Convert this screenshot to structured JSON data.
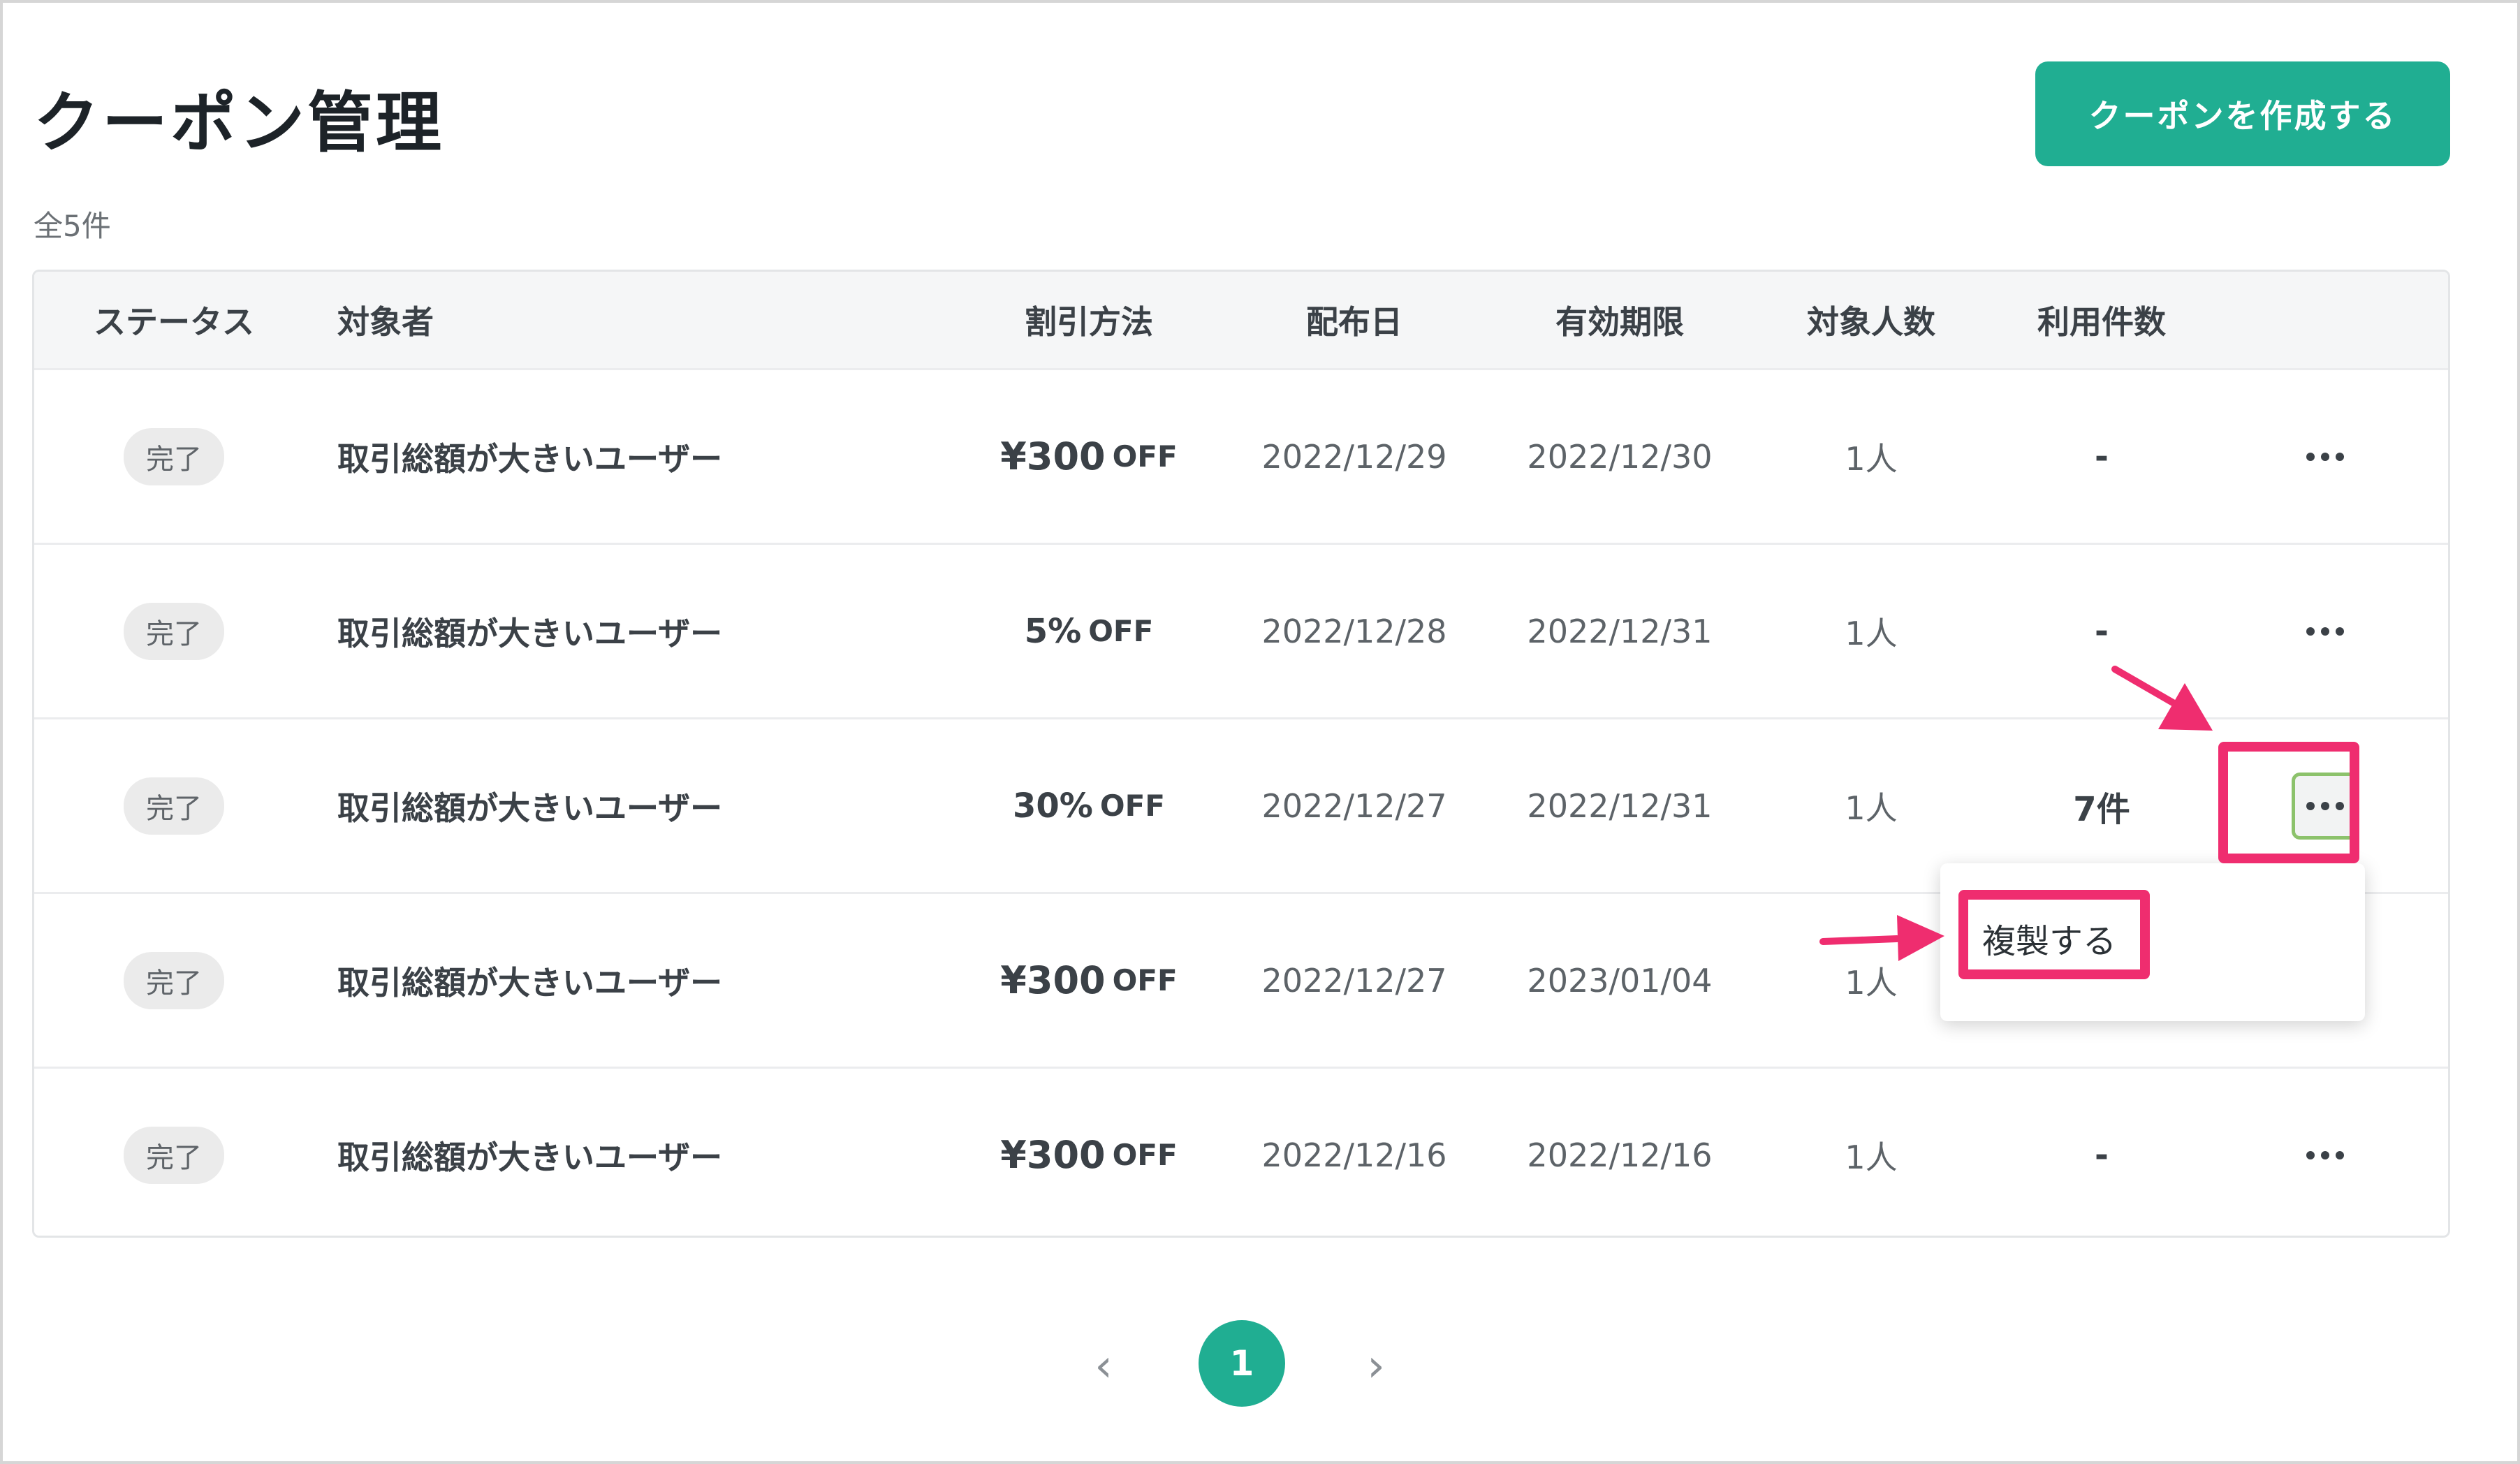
{
  "page": {
    "title": "クーポン管理",
    "create_label": "クーポンを作成する",
    "total_count": "全5件"
  },
  "table": {
    "headers": [
      "ステータス",
      "対象者",
      "割引方法",
      "配布日",
      "有効期限",
      "対象人数",
      "利用件数"
    ],
    "rows": [
      {
        "status": "完了",
        "target": "取引総額が大きいユーザー",
        "discount_amount": "¥300",
        "discount_unit": "OFF",
        "distributed": "2022/12/29",
        "expires": "2022/12/30",
        "people": "1人",
        "usage": "-"
      },
      {
        "status": "完了",
        "target": "取引総額が大きいユーザー",
        "discount_amount": "5%",
        "discount_unit": "OFF",
        "distributed": "2022/12/28",
        "expires": "2022/12/31",
        "people": "1人",
        "usage": "-"
      },
      {
        "status": "完了",
        "target": "取引総額が大きいユーザー",
        "discount_amount": "30%",
        "discount_unit": "OFF",
        "distributed": "2022/12/27",
        "expires": "2022/12/31",
        "people": "1人",
        "usage": "7件"
      },
      {
        "status": "完了",
        "target": "取引総額が大きいユーザー",
        "discount_amount": "¥300",
        "discount_unit": "OFF",
        "distributed": "2022/12/27",
        "expires": "2023/01/04",
        "people": "1人",
        "usage": ""
      },
      {
        "status": "完了",
        "target": "取引総額が大きいユーザー",
        "discount_amount": "¥300",
        "discount_unit": "OFF",
        "distributed": "2022/12/16",
        "expires": "2022/12/16",
        "people": "1人",
        "usage": "-"
      }
    ]
  },
  "dropdown": {
    "duplicate_label": "複製する"
  },
  "pagination": {
    "current": "1",
    "prev_icon": "chevron-left-icon",
    "next_icon": "chevron-right-icon"
  },
  "colors": {
    "accent": "#20ae92",
    "highlight": "#ef2d6f",
    "active_border": "#8cc26b"
  }
}
